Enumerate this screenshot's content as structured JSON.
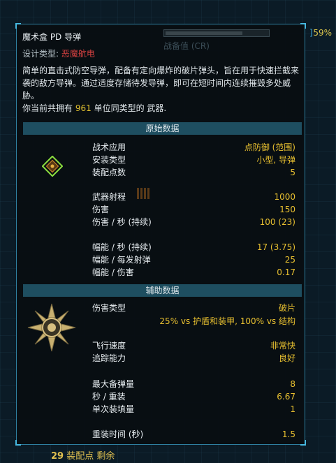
{
  "background": {
    "right_percent": "59%",
    "right_bracket": "]",
    "op_remaining_number": "29",
    "op_remaining_label": "装配点 剩余",
    "ghost_label": "战备值 (CR)"
  },
  "weapon": {
    "name": "魔术盒 PD 导弹",
    "design_type_label": "设计类型:",
    "design_type_value": "恶魔航电",
    "description": "简单的直击式防空导弹，配备有定向爆炸的破片弹头，旨在用于快速拦截来袭的敌方导弹。通过适度存储待发导弹，即可在短时间内连续摧毁多处威胁。",
    "owned_prefix": "你当前共拥有",
    "owned_count": "961",
    "owned_suffix": "单位同类型的 武器."
  },
  "primary": {
    "header": "原始数据",
    "rows": [
      {
        "label": "战术应用",
        "value": "点防御 (范围)"
      },
      {
        "label": "安装类型",
        "value": "小型, 导弹"
      },
      {
        "label": "装配点数",
        "value": "5"
      },
      {
        "label": "武器射程",
        "value": "1000"
      },
      {
        "label": "伤害",
        "value": "150"
      },
      {
        "label": "伤害 / 秒 (持续)",
        "value": "100 (23)"
      },
      {
        "label": "幅能 / 秒 (持续)",
        "value": "17 (3.75)"
      },
      {
        "label": "幅能 / 每发射弹",
        "value": "25"
      },
      {
        "label": "幅能 / 伤害",
        "value": "0.17"
      }
    ]
  },
  "ancillary": {
    "header": "辅助数据",
    "damage_type_label": "伤害类型",
    "damage_type_value": "破片",
    "damage_type_detail": "25% vs 护盾和装甲, 100% vs 结构",
    "rows": [
      {
        "label": "飞行速度",
        "value": "非常快"
      },
      {
        "label": "追踪能力",
        "value": "良好"
      },
      {
        "label": "最大备弹量",
        "value": "8"
      },
      {
        "label": "秒 / 重装",
        "value": "6.67"
      },
      {
        "label": "单次装填量",
        "value": "1"
      },
      {
        "label": "重装时间 (秒)",
        "value": "1.5"
      }
    ]
  },
  "colors": {
    "accent": "#e8c030",
    "design_type": "#d24040",
    "section_bg": "#1e4e60",
    "border": "#2e7fa0"
  }
}
